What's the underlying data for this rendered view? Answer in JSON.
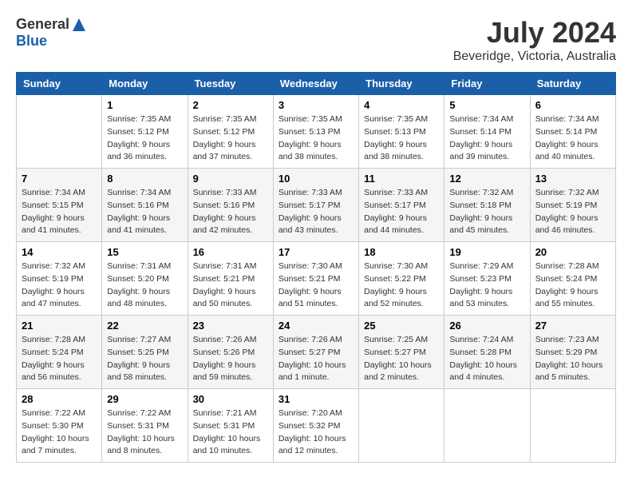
{
  "header": {
    "logo_general": "General",
    "logo_blue": "Blue",
    "title": "July 2024",
    "subtitle": "Beveridge, Victoria, Australia"
  },
  "calendar": {
    "days_of_week": [
      "Sunday",
      "Monday",
      "Tuesday",
      "Wednesday",
      "Thursday",
      "Friday",
      "Saturday"
    ],
    "weeks": [
      [
        {
          "day": "",
          "info": ""
        },
        {
          "day": "1",
          "info": "Sunrise: 7:35 AM\nSunset: 5:12 PM\nDaylight: 9 hours\nand 36 minutes."
        },
        {
          "day": "2",
          "info": "Sunrise: 7:35 AM\nSunset: 5:12 PM\nDaylight: 9 hours\nand 37 minutes."
        },
        {
          "day": "3",
          "info": "Sunrise: 7:35 AM\nSunset: 5:13 PM\nDaylight: 9 hours\nand 38 minutes."
        },
        {
          "day": "4",
          "info": "Sunrise: 7:35 AM\nSunset: 5:13 PM\nDaylight: 9 hours\nand 38 minutes."
        },
        {
          "day": "5",
          "info": "Sunrise: 7:34 AM\nSunset: 5:14 PM\nDaylight: 9 hours\nand 39 minutes."
        },
        {
          "day": "6",
          "info": "Sunrise: 7:34 AM\nSunset: 5:14 PM\nDaylight: 9 hours\nand 40 minutes."
        }
      ],
      [
        {
          "day": "7",
          "info": "Sunrise: 7:34 AM\nSunset: 5:15 PM\nDaylight: 9 hours\nand 41 minutes."
        },
        {
          "day": "8",
          "info": "Sunrise: 7:34 AM\nSunset: 5:16 PM\nDaylight: 9 hours\nand 41 minutes."
        },
        {
          "day": "9",
          "info": "Sunrise: 7:33 AM\nSunset: 5:16 PM\nDaylight: 9 hours\nand 42 minutes."
        },
        {
          "day": "10",
          "info": "Sunrise: 7:33 AM\nSunset: 5:17 PM\nDaylight: 9 hours\nand 43 minutes."
        },
        {
          "day": "11",
          "info": "Sunrise: 7:33 AM\nSunset: 5:17 PM\nDaylight: 9 hours\nand 44 minutes."
        },
        {
          "day": "12",
          "info": "Sunrise: 7:32 AM\nSunset: 5:18 PM\nDaylight: 9 hours\nand 45 minutes."
        },
        {
          "day": "13",
          "info": "Sunrise: 7:32 AM\nSunset: 5:19 PM\nDaylight: 9 hours\nand 46 minutes."
        }
      ],
      [
        {
          "day": "14",
          "info": "Sunrise: 7:32 AM\nSunset: 5:19 PM\nDaylight: 9 hours\nand 47 minutes."
        },
        {
          "day": "15",
          "info": "Sunrise: 7:31 AM\nSunset: 5:20 PM\nDaylight: 9 hours\nand 48 minutes."
        },
        {
          "day": "16",
          "info": "Sunrise: 7:31 AM\nSunset: 5:21 PM\nDaylight: 9 hours\nand 50 minutes."
        },
        {
          "day": "17",
          "info": "Sunrise: 7:30 AM\nSunset: 5:21 PM\nDaylight: 9 hours\nand 51 minutes."
        },
        {
          "day": "18",
          "info": "Sunrise: 7:30 AM\nSunset: 5:22 PM\nDaylight: 9 hours\nand 52 minutes."
        },
        {
          "day": "19",
          "info": "Sunrise: 7:29 AM\nSunset: 5:23 PM\nDaylight: 9 hours\nand 53 minutes."
        },
        {
          "day": "20",
          "info": "Sunrise: 7:28 AM\nSunset: 5:24 PM\nDaylight: 9 hours\nand 55 minutes."
        }
      ],
      [
        {
          "day": "21",
          "info": "Sunrise: 7:28 AM\nSunset: 5:24 PM\nDaylight: 9 hours\nand 56 minutes."
        },
        {
          "day": "22",
          "info": "Sunrise: 7:27 AM\nSunset: 5:25 PM\nDaylight: 9 hours\nand 58 minutes."
        },
        {
          "day": "23",
          "info": "Sunrise: 7:26 AM\nSunset: 5:26 PM\nDaylight: 9 hours\nand 59 minutes."
        },
        {
          "day": "24",
          "info": "Sunrise: 7:26 AM\nSunset: 5:27 PM\nDaylight: 10 hours\nand 1 minute."
        },
        {
          "day": "25",
          "info": "Sunrise: 7:25 AM\nSunset: 5:27 PM\nDaylight: 10 hours\nand 2 minutes."
        },
        {
          "day": "26",
          "info": "Sunrise: 7:24 AM\nSunset: 5:28 PM\nDaylight: 10 hours\nand 4 minutes."
        },
        {
          "day": "27",
          "info": "Sunrise: 7:23 AM\nSunset: 5:29 PM\nDaylight: 10 hours\nand 5 minutes."
        }
      ],
      [
        {
          "day": "28",
          "info": "Sunrise: 7:22 AM\nSunset: 5:30 PM\nDaylight: 10 hours\nand 7 minutes."
        },
        {
          "day": "29",
          "info": "Sunrise: 7:22 AM\nSunset: 5:31 PM\nDaylight: 10 hours\nand 8 minutes."
        },
        {
          "day": "30",
          "info": "Sunrise: 7:21 AM\nSunset: 5:31 PM\nDaylight: 10 hours\nand 10 minutes."
        },
        {
          "day": "31",
          "info": "Sunrise: 7:20 AM\nSunset: 5:32 PM\nDaylight: 10 hours\nand 12 minutes."
        },
        {
          "day": "",
          "info": ""
        },
        {
          "day": "",
          "info": ""
        },
        {
          "day": "",
          "info": ""
        }
      ]
    ]
  }
}
